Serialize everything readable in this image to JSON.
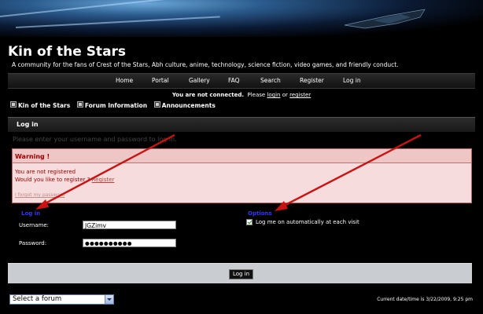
{
  "site": {
    "title": "Kin of the Stars",
    "description": "A community for the fans of Crest of the Stars, Abh culture, anime, technology, science fiction, video games, and friendly conduct."
  },
  "nav": {
    "items": [
      "Home",
      "Portal",
      "Gallery",
      "FAQ",
      "Search",
      "Register",
      "Log in"
    ]
  },
  "connection": {
    "status": "You are not connected.",
    "please": "Please",
    "login_link": "login",
    "or": "or",
    "register_link": "register"
  },
  "breadcrumb": {
    "items": [
      "Kin of the Stars",
      "Forum Information",
      "Announcements"
    ]
  },
  "section": {
    "title": "Log in",
    "prompt": "Please enter your username and password to log in."
  },
  "warning": {
    "title": "Warning !",
    "line1": "You are not registered",
    "line2": "Would you like to register ?",
    "register_link": "Register",
    "forgot": "I forgot my password"
  },
  "login_form": {
    "legend": "Log in",
    "username_label": "Username:",
    "username_value": "JGZimv",
    "password_label": "Password:",
    "password_value": "●●●●●●●●●●"
  },
  "options": {
    "legend": "Options",
    "autologin_label": "Log me on automatically at each visit",
    "autologin_checked": true
  },
  "submit": {
    "label": "Log in"
  },
  "footer": {
    "forum_select": "Select a forum",
    "datetime": "Current date/time is 3/22/2009, 9:25 pm"
  },
  "colors": {
    "arrow": "#cc1111",
    "legend": "#3333ff",
    "warning_text": "#a00000"
  }
}
